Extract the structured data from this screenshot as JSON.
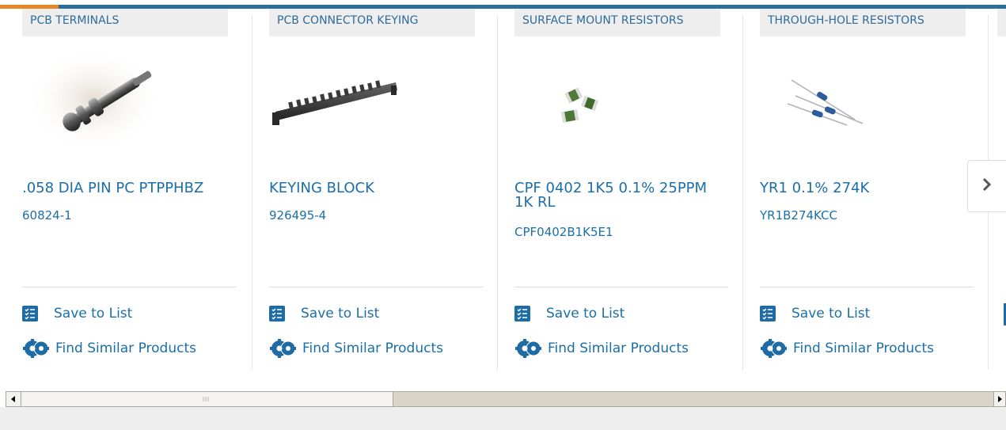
{
  "cards": [
    {
      "category": "PCB TERMINALS",
      "title": ".058 DIA PIN PC PTPPHBZ",
      "part": "60824-1",
      "save": "Save to List",
      "find": "Find Similar Products",
      "image": "pcb-terminal-pin"
    },
    {
      "category": "PCB CONNECTOR KEYING",
      "title": "KEYING BLOCK",
      "part": "926495-4",
      "save": "Save to List",
      "find": "Find Similar Products",
      "image": "keying-block"
    },
    {
      "category": "SURFACE MOUNT RESISTORS",
      "title": "CPF 0402 1K5 0.1% 25PPM 1K RL",
      "part": "CPF0402B1K5E1",
      "save": "Save to List",
      "find": "Find Similar Products",
      "image": "smd-resistors"
    },
    {
      "category": "THROUGH-HOLE RESISTORS",
      "title": "YR1 0.1% 274K",
      "part": "YR1B274KCC",
      "save": "Save to List",
      "find": "Find Similar Products",
      "image": "axial-resistors"
    }
  ],
  "carousel": {
    "next_icon": "chevron-right-icon"
  },
  "colors": {
    "accent": "#1b6fa8",
    "orange": "#e8872a",
    "category_bg": "#eeeeee"
  }
}
